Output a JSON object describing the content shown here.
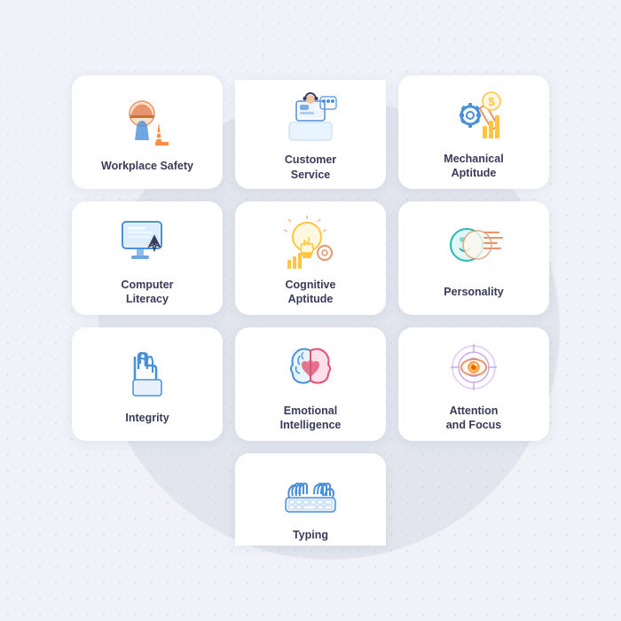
{
  "cards": [
    {
      "id": "workplace-safety",
      "label": "Workplace\nSafety",
      "col": 1,
      "row": 1,
      "icon": "hardhat"
    },
    {
      "id": "customer-service",
      "label": "Customer\nService",
      "col": 2,
      "row": 1,
      "partial": "top",
      "icon": "headset"
    },
    {
      "id": "mechanical-aptitude",
      "label": "Mechanical\nAptitude",
      "col": 3,
      "row": 1,
      "icon": "gears"
    },
    {
      "id": "computer-literacy",
      "label": "Computer\nLiteracy",
      "col": 1,
      "row": 2,
      "icon": "computer"
    },
    {
      "id": "cognitive-aptitude",
      "label": "Cognitive\nAptitude",
      "col": 2,
      "row": 2,
      "icon": "bulb"
    },
    {
      "id": "personality",
      "label": "Personality",
      "col": 3,
      "row": 2,
      "icon": "face"
    },
    {
      "id": "integrity",
      "label": "Integrity",
      "col": 1,
      "row": 3,
      "icon": "handshake"
    },
    {
      "id": "emotional-intelligence",
      "label": "Emotional\nIntelligence",
      "col": 2,
      "row": 3,
      "icon": "brain-heart"
    },
    {
      "id": "attention-and-focus",
      "label": "Attention\nand Focus",
      "col": 3,
      "row": 3,
      "icon": "eye-target"
    },
    {
      "id": "typing",
      "label": "Typing",
      "col": 2,
      "row": 4,
      "partial": "bottom",
      "icon": "keyboard"
    }
  ]
}
